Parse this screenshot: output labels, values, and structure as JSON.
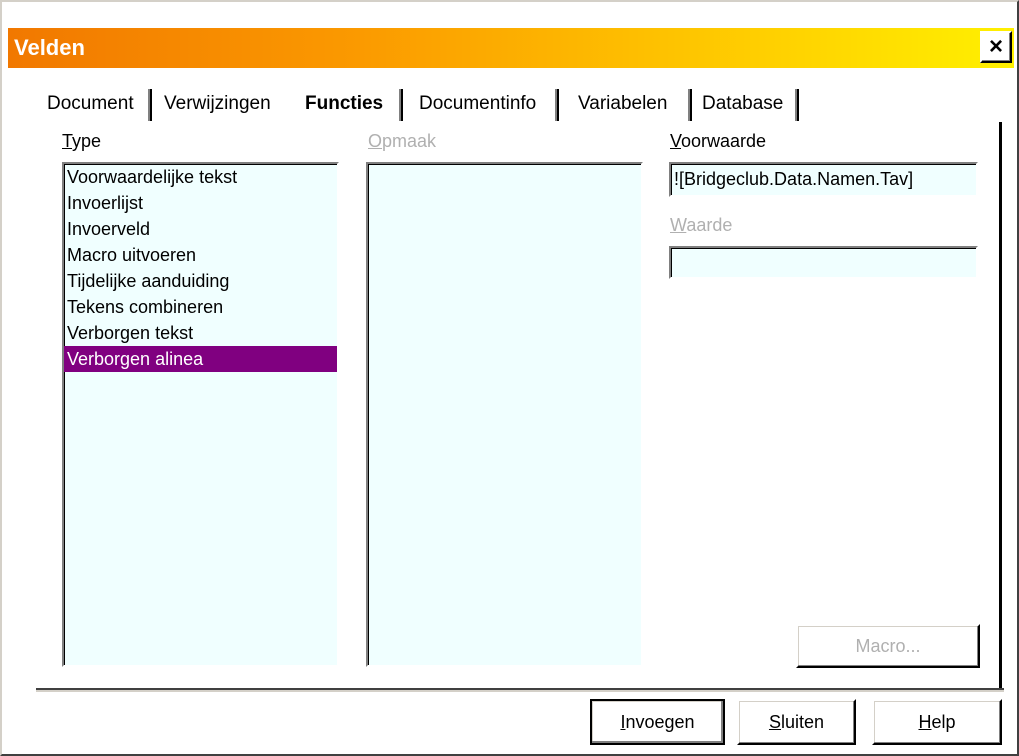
{
  "window": {
    "title": "Velden",
    "close_symbol": "×"
  },
  "tabs": [
    {
      "label": "Document",
      "active": false
    },
    {
      "label": "Verwijzingen",
      "active": false
    },
    {
      "label": "Functies",
      "active": true
    },
    {
      "label": "Documentinfo",
      "active": false
    },
    {
      "label": "Variabelen",
      "active": false
    },
    {
      "label": "Database",
      "active": false
    }
  ],
  "type": {
    "label": "Type",
    "items": [
      "Voorwaardelijke tekst",
      "Invoerlijst",
      "Invoerveld",
      "Macro uitvoeren",
      "Tijdelijke aanduiding",
      "Tekens combineren",
      "Verborgen tekst",
      "Verborgen alinea"
    ],
    "selected_index": 7
  },
  "opmaak": {
    "label": "Opmaak",
    "items": []
  },
  "voorwaarde": {
    "label": "Voorwaarde",
    "value": "![Bridgeclub.Data.Namen.Tav]"
  },
  "waarde": {
    "label": "Waarde",
    "value": ""
  },
  "buttons": {
    "macro": "Macro...",
    "invoegen": "Invoegen",
    "sluiten": "Sluiten",
    "help": "Help"
  },
  "colors": {
    "title_gradient_start": "#f17800",
    "title_gradient_end": "#fff000",
    "list_background": "#f0ffff",
    "selection": "#800080"
  }
}
